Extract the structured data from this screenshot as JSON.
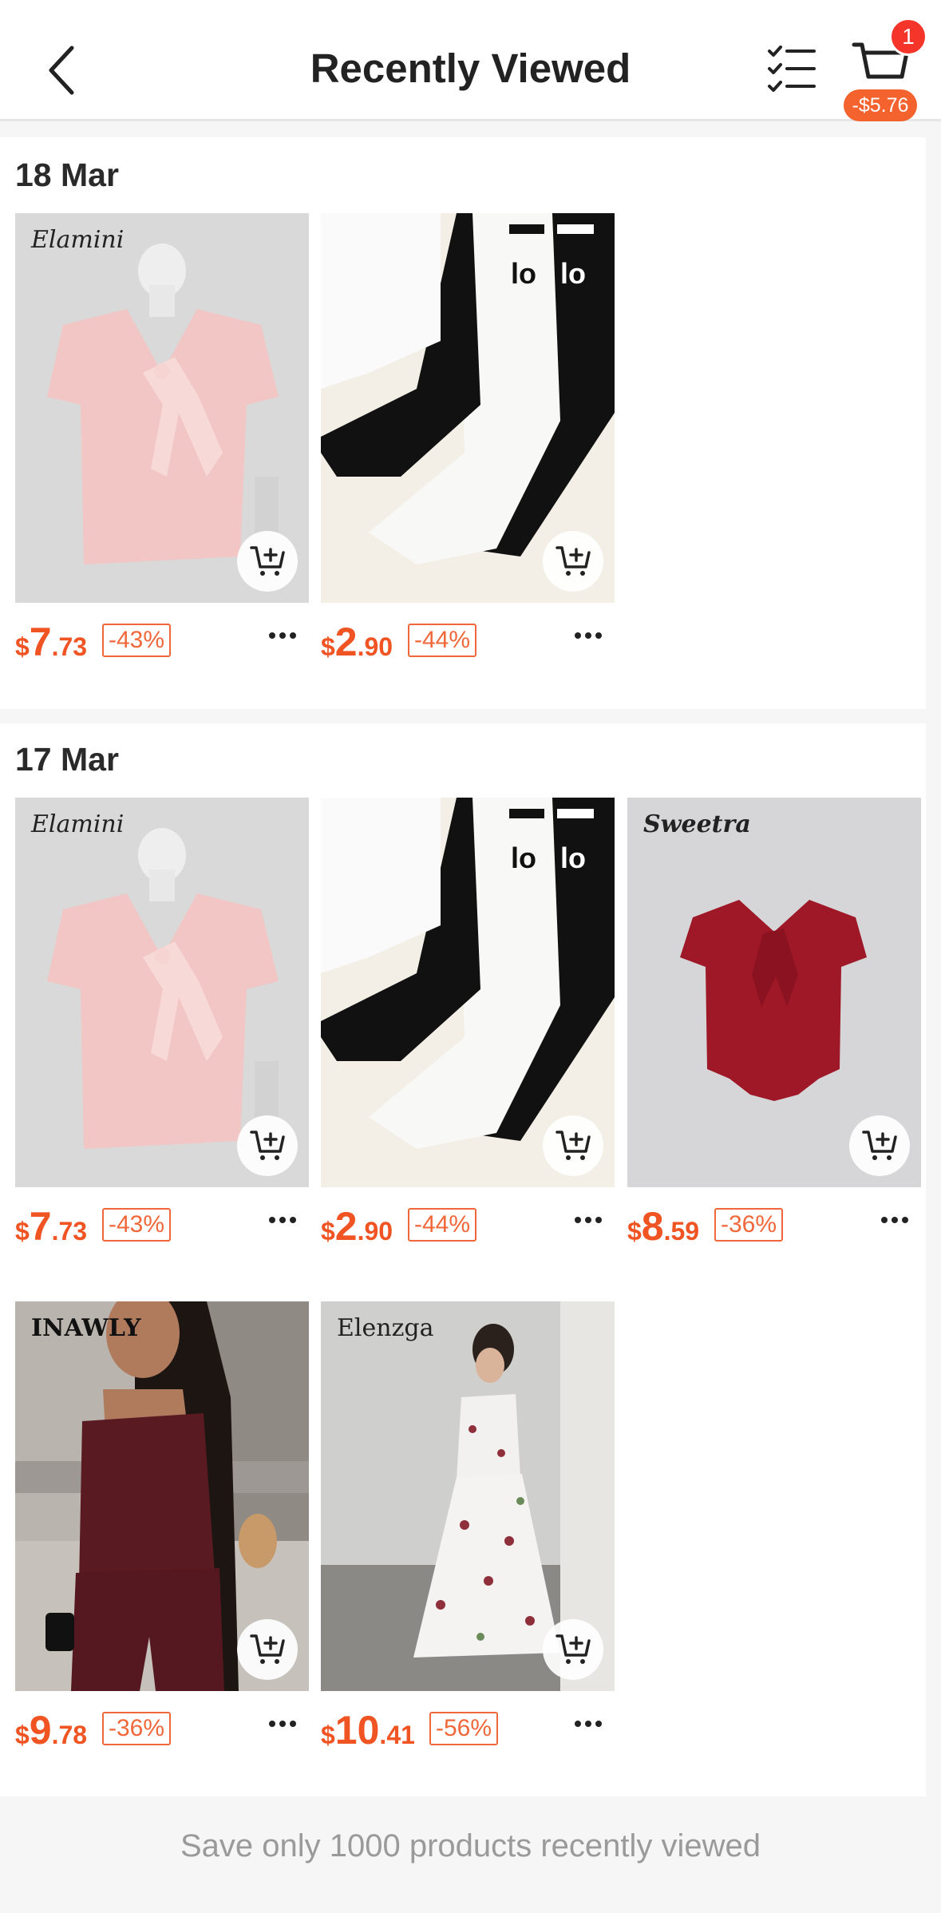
{
  "header": {
    "title": "Recently Viewed",
    "cart_count": "1",
    "cart_discount": "-$5.76"
  },
  "sections": [
    {
      "date": "18 Mar",
      "items": [
        {
          "brand": "Elamini",
          "product": "pink-bow-top",
          "currency": "$",
          "price_int": "7",
          "price_dec": ".73",
          "discount": "-43%"
        },
        {
          "brand": "",
          "product": "socks-set",
          "currency": "$",
          "price_int": "2",
          "price_dec": ".90",
          "discount": "-44%"
        }
      ]
    },
    {
      "date": "17 Mar",
      "items": [
        {
          "brand": "Elamini",
          "product": "pink-bow-top",
          "currency": "$",
          "price_int": "7",
          "price_dec": ".73",
          "discount": "-43%"
        },
        {
          "brand": "",
          "product": "socks-set",
          "currency": "$",
          "price_int": "2",
          "price_dec": ".90",
          "discount": "-44%"
        },
        {
          "brand": "Sweetra",
          "product": "red-bow-top",
          "currency": "$",
          "price_int": "8",
          "price_dec": ".59",
          "discount": "-36%"
        },
        {
          "brand": "INAWLY",
          "product": "burgundy-set",
          "currency": "$",
          "price_int": "9",
          "price_dec": ".78",
          "discount": "-36%"
        },
        {
          "brand": "Elenzga",
          "product": "floral-dress",
          "currency": "$",
          "price_int": "10",
          "price_dec": ".41",
          "discount": "-56%"
        }
      ]
    }
  ],
  "footer": {
    "note": "Save only 1000 products recently viewed"
  },
  "colors": {
    "price": "#f05423",
    "badge": "#f5352a",
    "accent_pill": "#f4622e"
  },
  "icons": [
    "back-icon",
    "checklist-icon",
    "cart-icon",
    "add-to-cart-icon",
    "more-icon"
  ]
}
